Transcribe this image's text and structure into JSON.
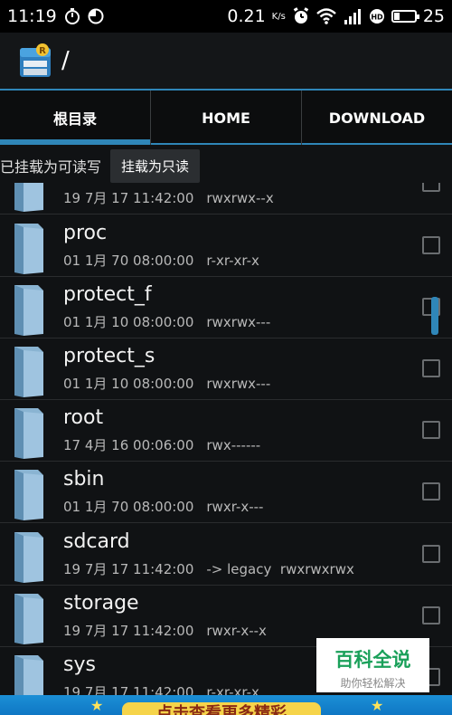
{
  "status_bar": {
    "time": "11:19",
    "speed": "0.21",
    "speed_unit": "K/s",
    "battery": "25",
    "battery_level": 0.25
  },
  "app_bar": {
    "path": "/"
  },
  "tabs": [
    {
      "label": "根目录",
      "active": true
    },
    {
      "label": "HOME",
      "active": false
    },
    {
      "label": "DOWNLOAD",
      "active": false
    }
  ],
  "mount": {
    "status_text": "已挂载为可读写",
    "button_label": "挂载为只读"
  },
  "files": [
    {
      "name": "",
      "date": "19 7月 17 11:42:00",
      "perm": "rwxrwx--x"
    },
    {
      "name": "proc",
      "date": "01 1月 70 08:00:00",
      "perm": "r-xr-xr-x"
    },
    {
      "name": "protect_f",
      "date": "01 1月 10 08:00:00",
      "perm": "rwxrwx---"
    },
    {
      "name": "protect_s",
      "date": "01 1月 10 08:00:00",
      "perm": "rwxrwx---"
    },
    {
      "name": "root",
      "date": "17 4月 16 00:06:00",
      "perm": "rwx------"
    },
    {
      "name": "sbin",
      "date": "01 1月 70 08:00:00",
      "perm": "rwxr-x---"
    },
    {
      "name": "sdcard",
      "date": "19 7月 17 11:42:00",
      "perm": "-> legacy  rwxrwxrwx"
    },
    {
      "name": "storage",
      "date": "19 7月 17 11:42:00",
      "perm": "rwxr-x--x"
    },
    {
      "name": "sys",
      "date": "19 7月 17 11:42:00",
      "perm": "r-xr-xr-x"
    }
  ],
  "watermark": {
    "title": "百科全说",
    "subtitle": "助你轻松解决"
  },
  "ad": {
    "text": "点击查看更多精彩"
  },
  "colors": {
    "accent": "#2f86b8",
    "background": "#101214",
    "watermark_green": "#1aa05a",
    "ad_blue": "#1b8fd6",
    "ad_yellow": "#f6d44a"
  }
}
